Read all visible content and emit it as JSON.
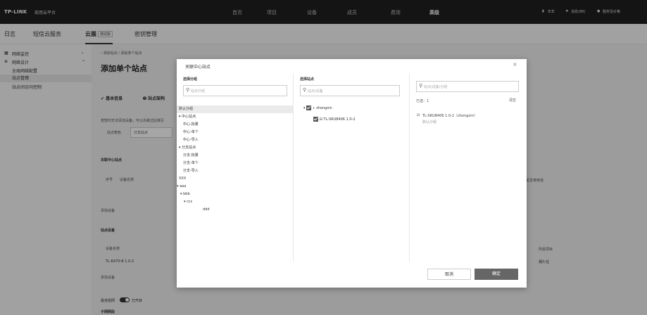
{
  "topbar": {
    "logo": "TP-LINK",
    "logo_sub": "商用云平台",
    "nav": [
      "首页",
      "项目",
      "设备",
      "成员",
      "费用",
      "高级"
    ],
    "right": [
      "年年",
      "消息(88)",
      "服务及价格"
    ]
  },
  "tabs2": {
    "items": [
      "日志",
      "短信云服务",
      "云展",
      "密钥管理"
    ],
    "badge": "测试版"
  },
  "sidebar": {
    "items": [
      {
        "label": "网络监控",
        "expand": "›"
      },
      {
        "label": "网络设计",
        "expand": "⌄"
      },
      {
        "label": "全局网络配置"
      },
      {
        "label": "站点管理"
      },
      {
        "label": "站点间访问控制"
      }
    ]
  },
  "main": {
    "breadcrumb": "‹ 添加站点 / 添加单个站点",
    "title": "添加单个站点",
    "step1": "基本信息",
    "step2": "站点架构",
    "hint": "若暂时无法添加设备，可以先跳过后填写",
    "role_label": "站点角色",
    "role_value": "分支站点",
    "section_hub": "关联中心站点",
    "col_no": "序号",
    "col_name": "设备名称",
    "col_used": "是否使用道",
    "add_device": "添加设备",
    "section_devices": "站点设备",
    "col_dev_name": "设备名称",
    "col_project": "所属项目",
    "dev_row": {
      "name": "TL-R470-B 1.0-2",
      "project": "偶久任"
    },
    "add_device2": "添加设备",
    "networking_label": "最佳组网",
    "networking_status": "已开启",
    "sub_section": "子网网段"
  },
  "modal": {
    "title": "关联中心站点",
    "close": "×",
    "col1": {
      "header": "选择分组",
      "placeholder": "站点分组",
      "groups": [
        "默认分组",
        "▾ 中心站点",
        "中心-批量",
        "中心-单个",
        "中心-导入",
        "▾ 分支站点",
        "分支-批量",
        "分支-单个",
        "分支-导入",
        "XXX",
        "▾ aaa",
        "▾ bbb",
        "▾ ccc",
        "ddd"
      ]
    },
    "col2": {
      "header": "选择站点",
      "placeholder": "站点/设备",
      "site": "zhongxin",
      "device": "TL-SRU8406 1.0-2"
    },
    "col3": {
      "placeholder": "站点/设备/分组",
      "selected_label": "已选：1",
      "clear": "清空",
      "sel_device": "TL-SRU8406 1.0-2（zhongxin）",
      "sel_group": "默认分组"
    },
    "cancel": "取消",
    "ok": "确定"
  }
}
